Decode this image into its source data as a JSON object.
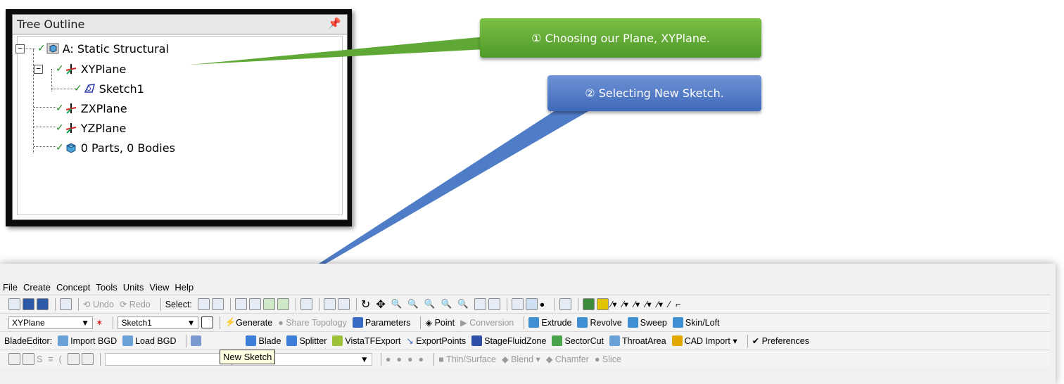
{
  "tree": {
    "title": "Tree Outline",
    "pin_icon": "pin-icon",
    "nodes": [
      {
        "label": "A: Static Structural",
        "icon": "project-icon"
      },
      {
        "label": "XYPlane",
        "icon": "plane-icon"
      },
      {
        "label": "Sketch1",
        "icon": "sketch-icon"
      },
      {
        "label": "ZXPlane",
        "icon": "plane-icon"
      },
      {
        "label": "YZPlane",
        "icon": "plane-icon"
      },
      {
        "label": "0 Parts, 0 Bodies",
        "icon": "bodies-icon"
      }
    ]
  },
  "callouts": {
    "step1": "① Choosing our Plane, XYPlane.",
    "step2": "② Selecting New Sketch.",
    "step1_color": "#5fa836",
    "step2_color": "#4f7cc6"
  },
  "menu": [
    "File",
    "Create",
    "Concept",
    "Tools",
    "Units",
    "View",
    "Help"
  ],
  "toolbar1": {
    "undo": "Undo",
    "redo": "Redo",
    "select": "Select:"
  },
  "toolbar2": {
    "plane_value": "XYPlane",
    "sketch_value": "Sketch1",
    "generate": "Generate",
    "share_topology": "Share Topology",
    "parameters": "Parameters",
    "point": "Point",
    "conversion": "Conversion",
    "extrude": "Extrude",
    "revolve": "Revolve",
    "sweep": "Sweep",
    "skin_loft": "Skin/Loft"
  },
  "toolbar3": {
    "blade_editor": "BladeEditor:",
    "import_bgd": "Import BGD",
    "load_bgd": "Load BGD",
    "blade": "Blade",
    "splitter": "Splitter",
    "vista_tf_export": "VistaTFExport",
    "export_points": "ExportPoints",
    "stage_fluid_zone": "StageFluidZone",
    "sector_cut": "SectorCut",
    "throat_area": "ThroatArea",
    "cad_import": "CAD Import ▾",
    "preferences": "Preferences"
  },
  "toolbar4": {
    "thin_surface": "Thin/Surface",
    "blend": "Blend ▾",
    "chamfer": "Chamfer",
    "slice": "Slice"
  },
  "tooltip": "New Sketch"
}
